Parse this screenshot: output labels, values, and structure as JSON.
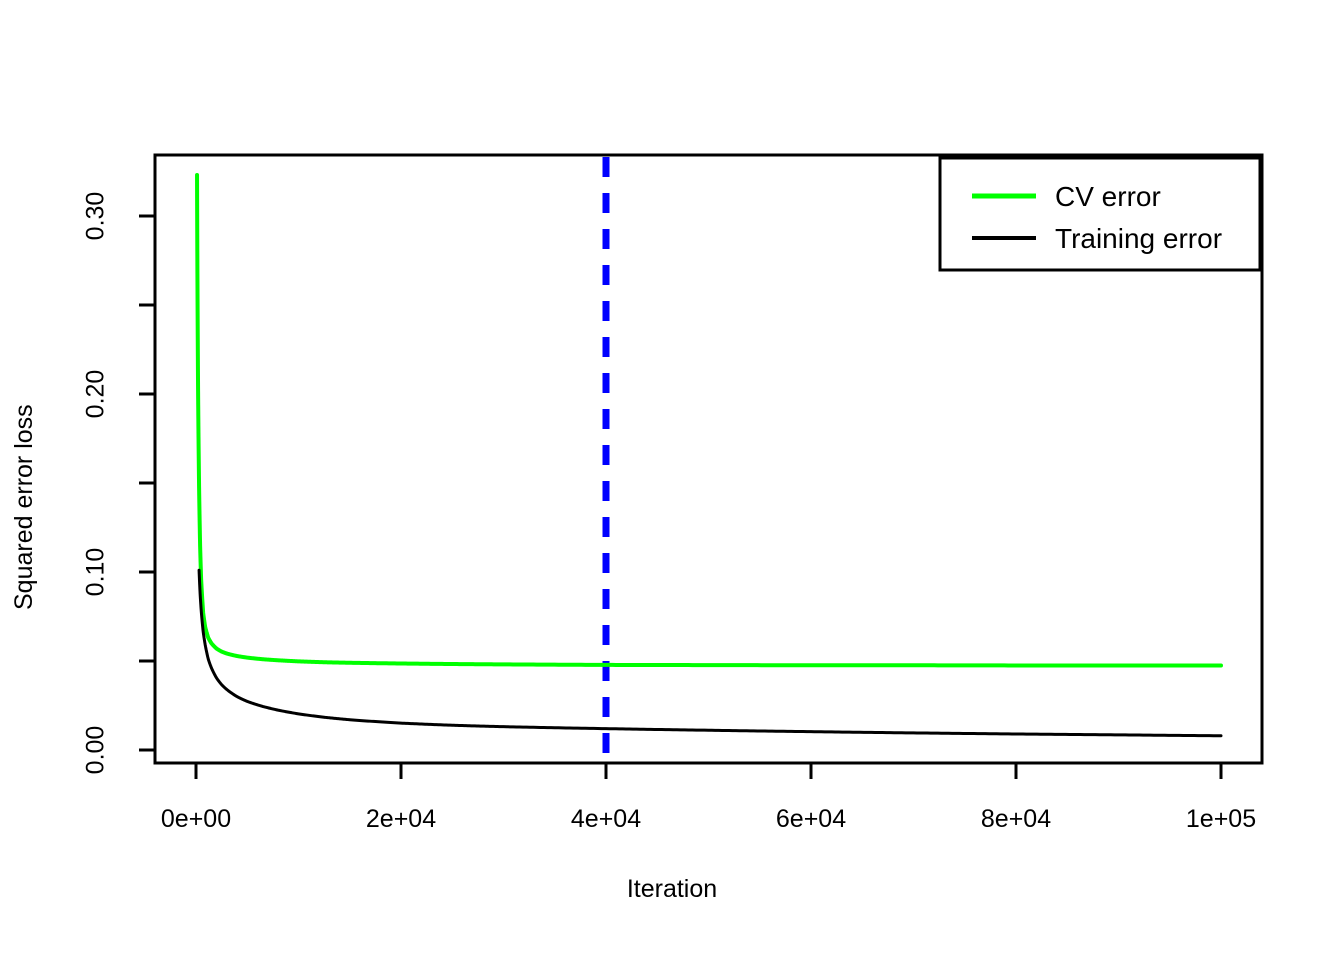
{
  "chart": {
    "type": "line",
    "title": "",
    "xlabel": "Iteration",
    "ylabel": "Squared error loss",
    "background": "#ffffff",
    "foreground": "#000000"
  },
  "axes": {
    "x": {
      "label": "Iteration",
      "tick_labels": [
        "0e+00",
        "2e+04",
        "4e+04",
        "6e+04",
        "8e+04",
        "1e+05"
      ],
      "tick_values": [
        0,
        20000,
        40000,
        60000,
        80000,
        100000
      ],
      "min": 0,
      "max": 100000
    },
    "y": {
      "label": "Squared error loss",
      "tick_labels": [
        "0.00",
        "",
        "0.10",
        "",
        "0.20",
        "",
        "0.30"
      ],
      "tick_values": [
        0.0,
        0.05,
        0.1,
        0.15,
        0.2,
        0.25,
        0.3
      ],
      "labeled_ticks": [
        "0.00",
        "0.10",
        "0.20",
        "0.30"
      ],
      "min": 0.0,
      "max": 0.3
    },
    "grid": "off"
  },
  "legend": {
    "position": "top-right",
    "border": "#000000",
    "entries": [
      {
        "label": "CV error",
        "color": "#00ff00",
        "style": "solid",
        "width": 3
      },
      {
        "label": "Training error",
        "color": "#000000",
        "style": "solid",
        "width": 2
      }
    ]
  },
  "annotations": [
    {
      "name": "optimal-iteration-marker",
      "type": "vertical-line",
      "x": 40000,
      "color": "#0000ff",
      "style": "dashed",
      "width": 6
    }
  ],
  "chart_data": {
    "type": "line",
    "title": "",
    "xlabel": "Iteration",
    "ylabel": "Squared error loss",
    "xlim": [
      0,
      100000
    ],
    "ylim": [
      0,
      0.3
    ],
    "grid": false,
    "legend_position": "top right",
    "annotations": [
      {
        "type": "vline",
        "x": 40000,
        "color": "#0000ff",
        "linestyle": "dashed",
        "label": ""
      }
    ],
    "series": [
      {
        "name": "CV error",
        "color": "#00ff00",
        "x": [
          100,
          200,
          300,
          400,
          500,
          700,
          900,
          1200,
          1500,
          2000,
          2500,
          3000,
          4000,
          5000,
          6500,
          8000,
          10000,
          12500,
          15000,
          20000,
          25000,
          30000,
          40000,
          50000,
          60000,
          70000,
          80000,
          90000,
          100000
        ],
        "y": [
          0.323,
          0.204,
          0.148,
          0.115,
          0.096,
          0.077,
          0.069,
          0.063,
          0.06,
          0.057,
          0.0553,
          0.0542,
          0.0528,
          0.0519,
          0.051,
          0.0504,
          0.0498,
          0.0493,
          0.049,
          0.0486,
          0.0483,
          0.0481,
          0.0478,
          0.0477,
          0.0476,
          0.0476,
          0.0475,
          0.0475,
          0.0475
        ]
      },
      {
        "name": "Training error",
        "color": "#000000",
        "x": [
          300,
          400,
          500,
          700,
          900,
          1200,
          1500,
          2000,
          2500,
          3000,
          4000,
          5000,
          6500,
          8000,
          10000,
          12500,
          15000,
          20000,
          25000,
          30000,
          40000,
          50000,
          60000,
          70000,
          80000,
          90000,
          100000
        ],
        "y": [
          0.101,
          0.088,
          0.079,
          0.0665,
          0.059,
          0.051,
          0.0462,
          0.0405,
          0.0367,
          0.034,
          0.03,
          0.0273,
          0.0245,
          0.0224,
          0.0203,
          0.0184,
          0.017,
          0.0151,
          0.0139,
          0.0131,
          0.012,
          0.0111,
          0.0103,
          0.0096,
          0.009,
          0.0085,
          0.008
        ]
      }
    ]
  }
}
